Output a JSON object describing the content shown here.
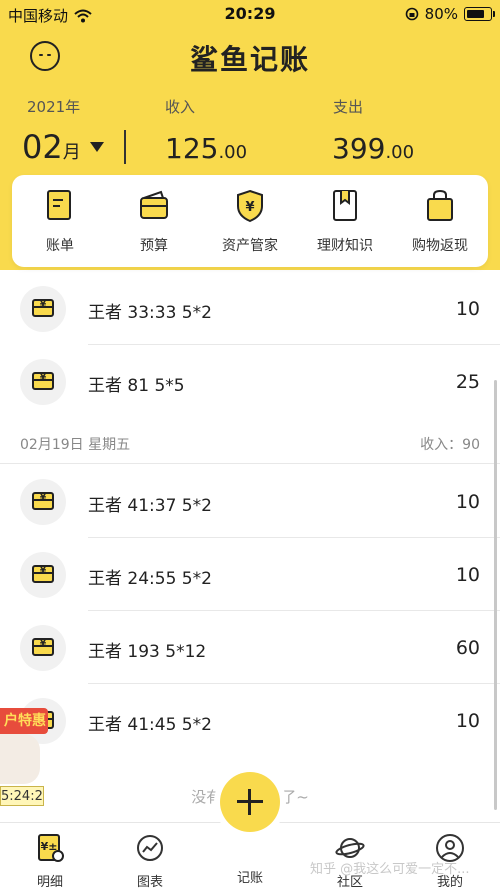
{
  "status_bar": {
    "carrier": "中国移动",
    "time": "20:29",
    "battery": "80%"
  },
  "app": {
    "title": "鲨鱼记账"
  },
  "summary": {
    "year": "2021年",
    "month_num": "02",
    "month_unit": "月",
    "income_label": "收入",
    "expense_label": "支出",
    "income_int": "125",
    "income_dec": ".00",
    "expense_int": "399",
    "expense_dec": ".00"
  },
  "menu": [
    {
      "label": "账单",
      "icon": "bill-icon"
    },
    {
      "label": "预算",
      "icon": "wallet-icon"
    },
    {
      "label": "资产管家",
      "icon": "shield-yen-icon"
    },
    {
      "label": "理财知识",
      "icon": "bookmark-book-icon"
    },
    {
      "label": "购物返现",
      "icon": "shopping-bag-icon"
    }
  ],
  "records": [
    {
      "label": "王者 33:33 5*2",
      "amount": "10"
    },
    {
      "label": "王者 81 5*5",
      "amount": "25"
    }
  ],
  "date_group": {
    "date": "02月19日  星期五",
    "income": "收入：90"
  },
  "records2": [
    {
      "label": "王者 41:37 5*2",
      "amount": "10"
    },
    {
      "label": "王者 24:55 5*2",
      "amount": "10"
    },
    {
      "label": "王者 193 5*12",
      "amount": "60"
    },
    {
      "label": "王者 41:45 5*2",
      "amount": "10"
    }
  ],
  "footer_note": "没有更多数据了~",
  "float_ad": {
    "banner": "户特惠",
    "timer": "5:24:2"
  },
  "tabs": [
    {
      "label": "明细",
      "icon": "detail-icon"
    },
    {
      "label": "图表",
      "icon": "chart-icon"
    },
    {
      "label": "记账",
      "icon": "plus-icon"
    },
    {
      "label": "社区",
      "icon": "planet-icon"
    },
    {
      "label": "我的",
      "icon": "user-icon"
    }
  ],
  "watermark": "知乎 @我这么可爱一定不...",
  "colors": {
    "accent": "#f9da4d",
    "text": "#222222",
    "muted": "#888888"
  }
}
